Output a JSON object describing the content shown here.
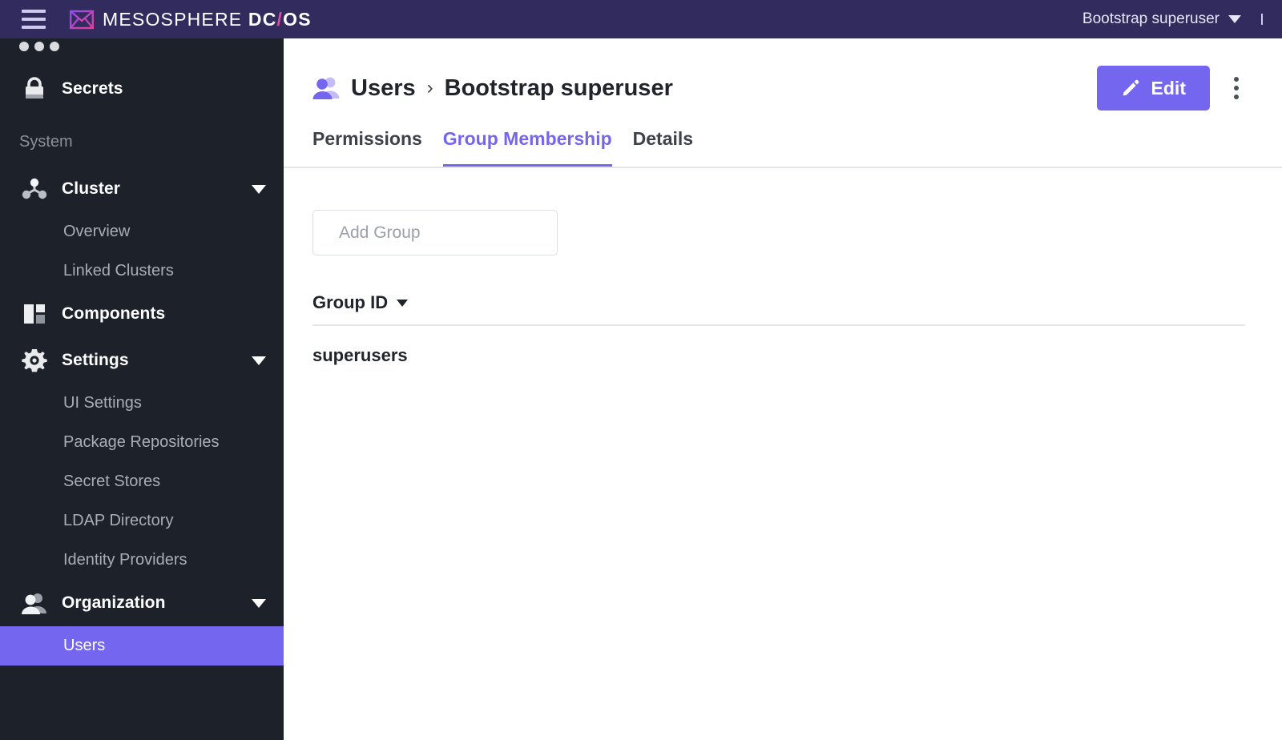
{
  "topbar": {
    "menu_icon": "hamburger-icon",
    "brand_primary": "MESOSPHERE",
    "brand_dc": "DC",
    "brand_slash": "/",
    "brand_os": "OS",
    "user_name": "Bootstrap superuser",
    "caret_icon": "caret-down-icon",
    "colors": {
      "bg": "#322c5e",
      "accent_pink": "#e04b9e"
    }
  },
  "sidebar": {
    "bg_color": "#1c212a",
    "active_color": "#7566f0",
    "truncated_top_item": {
      "label": "",
      "icon": "three-dots-icon"
    },
    "top_items": [
      {
        "label": "Secrets",
        "icon": "lock-icon"
      }
    ],
    "section_label": "System",
    "groups": [
      {
        "label": "Cluster",
        "icon": "cluster-nodes-icon",
        "chevron": "chevron-down-icon",
        "children": [
          {
            "label": "Overview",
            "active": false
          },
          {
            "label": "Linked Clusters",
            "active": false
          }
        ]
      },
      {
        "label": "Components",
        "icon": "components-icon",
        "chevron": "",
        "children": []
      },
      {
        "label": "Settings",
        "icon": "gear-icon",
        "chevron": "chevron-down-icon",
        "children": [
          {
            "label": "UI Settings",
            "active": false
          },
          {
            "label": "Package Repositories",
            "active": false
          },
          {
            "label": "Secret Stores",
            "active": false
          },
          {
            "label": "LDAP Directory",
            "active": false
          },
          {
            "label": "Identity Providers",
            "active": false
          }
        ]
      },
      {
        "label": "Organization",
        "icon": "users-icon",
        "chevron": "chevron-down-icon",
        "children": [
          {
            "label": "Users",
            "active": true
          }
        ]
      }
    ]
  },
  "main": {
    "breadcrumb": {
      "icon": "users-icon",
      "parent": "Users",
      "separator": "›",
      "current": "Bootstrap superuser"
    },
    "actions": {
      "edit_label": "Edit",
      "edit_icon": "pencil-icon",
      "edit_color": "#7566f0",
      "more_icon": "kebab-menu-icon"
    },
    "tabs": [
      {
        "label": "Permissions",
        "active": false
      },
      {
        "label": "Group Membership",
        "active": true
      },
      {
        "label": "Details",
        "active": false
      }
    ],
    "search": {
      "icon": "search-icon",
      "placeholder": "Add Group",
      "value": ""
    },
    "table": {
      "columns": [
        {
          "label": "Group ID",
          "sort_icon": "caret-down-icon"
        }
      ],
      "rows": [
        {
          "group_id": "superusers"
        }
      ]
    }
  }
}
